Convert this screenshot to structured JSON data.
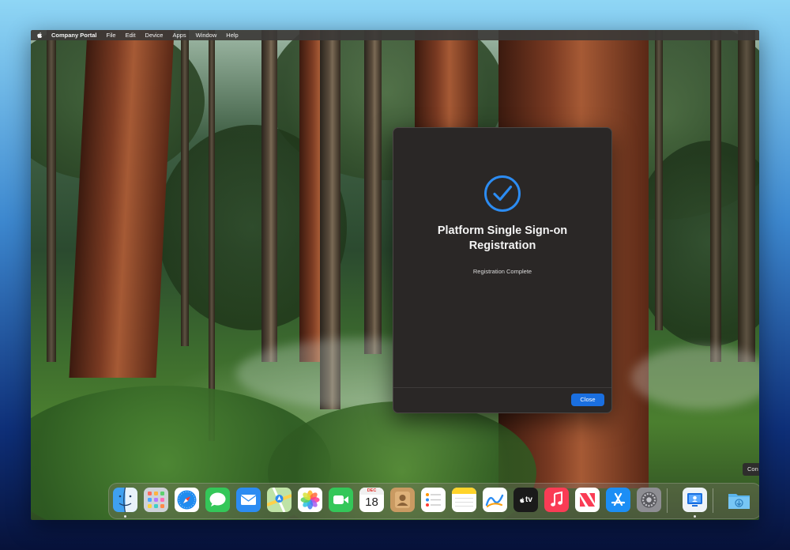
{
  "menubar": {
    "apple_icon": "apple-icon",
    "app_name": "Company Portal",
    "items": [
      "File",
      "Edit",
      "Device",
      "Apps",
      "Window",
      "Help"
    ]
  },
  "dialog": {
    "icon": "checkmark-circle-icon",
    "title_line1": "Platform Single Sign-on",
    "title_line2": "Registration",
    "subtitle": "Registration Complete",
    "close_label": "Close",
    "accent_color": "#1a6fe0",
    "check_color": "#2c8cf2"
  },
  "dock": {
    "calendar_month": "DEC",
    "calendar_day": "18",
    "tv_label": "tv",
    "apps": [
      "Finder",
      "Launchpad",
      "Safari",
      "Messages",
      "Mail",
      "Maps",
      "Photos",
      "FaceTime",
      "Calendar",
      "Contacts",
      "Reminders",
      "Notes",
      "Freeform",
      "TV",
      "Music",
      "News",
      "App Store",
      "System Settings",
      "Company Portal",
      "Downloads"
    ],
    "running": [
      "Finder",
      "Company Portal"
    ]
  },
  "background_window": {
    "peek_text": "Con"
  }
}
